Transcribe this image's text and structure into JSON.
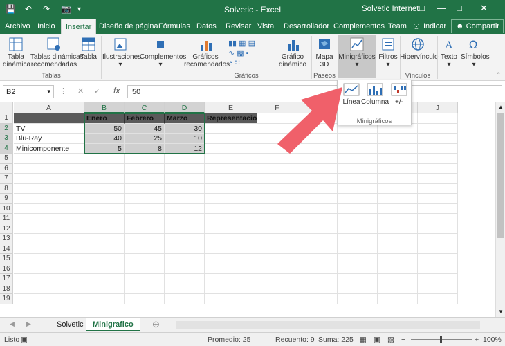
{
  "window": {
    "title": "Solvetic  -  Excel",
    "user": "Solvetic Internet"
  },
  "tabs": [
    "Archivo",
    "Inicio",
    "Insertar",
    "Diseño de página",
    "Fórmulas",
    "Datos",
    "Revisar",
    "Vista",
    "Desarrollador",
    "Complementos",
    "Team"
  ],
  "active_tab": "Insertar",
  "tell_me": "Indicar",
  "share": "Compartir",
  "ribbon": {
    "tabla_dinamica": [
      "Tabla",
      "dinámica"
    ],
    "tablas_recomendadas": [
      "Tablas dinámicas",
      "recomendadas"
    ],
    "tabla": "Tabla",
    "ilustraciones": "Ilustraciones",
    "complementos": "Complementos",
    "graficos_recomendados": [
      "Gráficos",
      "recomendados"
    ],
    "grafico_dinamico": [
      "Gráfico",
      "dinámico"
    ],
    "mapa3d": [
      "Mapa",
      "3D"
    ],
    "minigraficos": "Minigráficos",
    "filtros": "Filtros",
    "hipervinculo": "Hipervínculo",
    "texto": "Texto",
    "simbolos": "Símbolos",
    "groups": {
      "tablas": "Tablas",
      "graficos": "Gráficos",
      "paseos": "Paseos",
      "vinculos": "Vínculos"
    }
  },
  "dropdown": {
    "items": [
      "Línea",
      "Columna",
      "+/-"
    ],
    "group": "Minigráficos"
  },
  "formula_bar": {
    "name_box": "B2",
    "fx": "fx",
    "value": "50"
  },
  "columns": [
    "A",
    "B",
    "C",
    "D",
    "E",
    "F",
    "G",
    "H",
    "I",
    "J"
  ],
  "rows": [
    "1",
    "2",
    "3",
    "4",
    "5",
    "6",
    "7",
    "8",
    "9",
    "10",
    "11",
    "12",
    "13",
    "14",
    "15",
    "16",
    "17",
    "18",
    "19"
  ],
  "table": {
    "headers": [
      "Enero",
      "Febrero",
      "Marzo",
      "Representacion"
    ],
    "labels": [
      "TV",
      "Blu-Ray",
      "Minicomponente"
    ],
    "values": [
      [
        "50",
        "45",
        "30"
      ],
      [
        "40",
        "25",
        "10"
      ],
      [
        "5",
        "8",
        "12"
      ]
    ]
  },
  "sheets": [
    "Solvetic",
    "Minigrafico"
  ],
  "active_sheet": "Minigrafico",
  "status": {
    "ready": "Listo",
    "average": "Promedio: 25",
    "count": "Recuento: 9",
    "sum": "Suma: 225",
    "zoom": "100%"
  },
  "colors": {
    "excel_green": "#217346",
    "arrow_red": "#f0606a"
  }
}
